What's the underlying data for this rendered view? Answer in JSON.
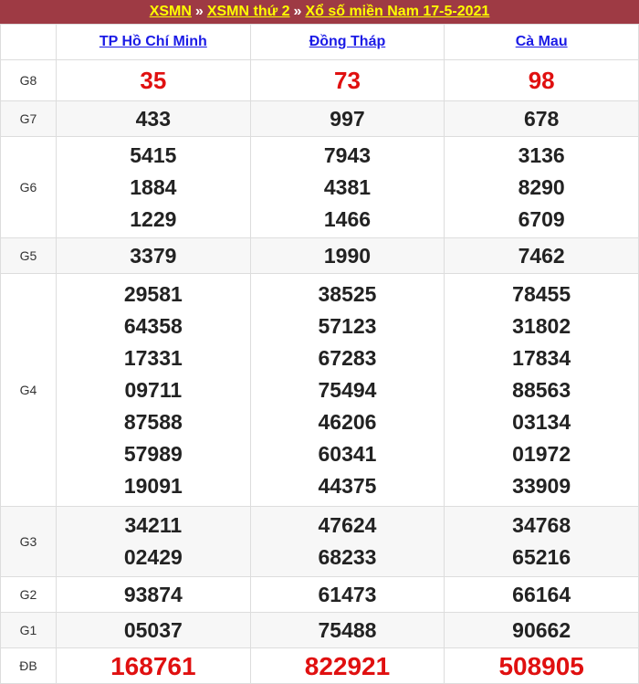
{
  "title": {
    "link1": "XSMN",
    "sep1": "»",
    "link2": "XSMN thứ 2",
    "sep2": "»",
    "link3": "Xổ số miền Nam 17-5-2021"
  },
  "provinces": [
    "TP Hồ Chí Minh",
    "Đồng Tháp",
    "Cà Mau"
  ],
  "prizes": [
    {
      "label": "G8",
      "values": [
        [
          "35"
        ],
        [
          "73"
        ],
        [
          "98"
        ]
      ]
    },
    {
      "label": "G7",
      "values": [
        [
          "433"
        ],
        [
          "997"
        ],
        [
          "678"
        ]
      ]
    },
    {
      "label": "G6",
      "values": [
        [
          "5415",
          "1884",
          "1229"
        ],
        [
          "7943",
          "4381",
          "1466"
        ],
        [
          "3136",
          "8290",
          "6709"
        ]
      ]
    },
    {
      "label": "G5",
      "values": [
        [
          "3379"
        ],
        [
          "1990"
        ],
        [
          "7462"
        ]
      ]
    },
    {
      "label": "G4",
      "values": [
        [
          "29581",
          "64358",
          "17331",
          "09711",
          "87588",
          "57989",
          "19091"
        ],
        [
          "38525",
          "57123",
          "67283",
          "75494",
          "46206",
          "60341",
          "44375"
        ],
        [
          "78455",
          "31802",
          "17834",
          "88563",
          "03134",
          "01972",
          "33909"
        ]
      ]
    },
    {
      "label": "G3",
      "values": [
        [
          "34211",
          "02429"
        ],
        [
          "47624",
          "68233"
        ],
        [
          "34768",
          "65216"
        ]
      ]
    },
    {
      "label": "G2",
      "values": [
        [
          "93874"
        ],
        [
          "61473"
        ],
        [
          "66164"
        ]
      ]
    },
    {
      "label": "G1",
      "values": [
        [
          "05037"
        ],
        [
          "75488"
        ],
        [
          "90662"
        ]
      ]
    },
    {
      "label": "ĐB",
      "values": [
        [
          "168761"
        ],
        [
          "822921"
        ],
        [
          "508905"
        ]
      ]
    }
  ]
}
